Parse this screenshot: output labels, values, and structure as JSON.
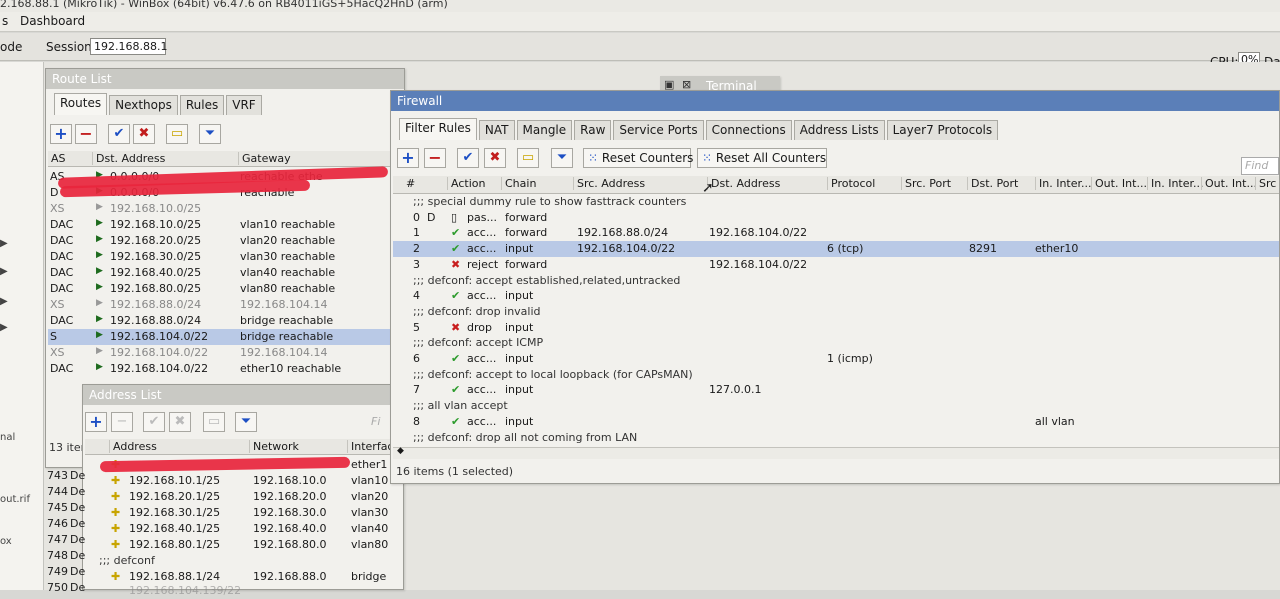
{
  "titlebar": {
    "text": "2.168.88.1 (MikroTik) - WinBox (64bit) v6.47.6 on RB4011iGS+5HacQ2HnD (arm)"
  },
  "menubar": {
    "items": [
      "s",
      "Dashboard"
    ]
  },
  "toolbar": {
    "mode_label": "ode",
    "session_label": "Session:",
    "session_value": "192.168.88.1",
    "cpu_label": "CPU:",
    "cpu_value": "0%",
    "right_label": "Da"
  },
  "left_strip": {
    "labels": [
      "nal",
      "out.rif",
      "ox"
    ]
  },
  "route_list": {
    "title": "Route List",
    "tabs": [
      "Routes",
      "Nexthops",
      "Rules",
      "VRF"
    ],
    "columns": [
      "AS",
      "Dst. Address",
      "Gateway"
    ],
    "rows": [
      {
        "flags": "AS",
        "dst": "0.0.0.0/0",
        "gw": "reachable ethe"
      },
      {
        "flags": "D",
        "dst": "0.0.0.0/0",
        "gw": "reachable"
      },
      {
        "flags": "XS",
        "dst": "192.168.10.0/25",
        "gw": ""
      },
      {
        "flags": "DAC",
        "dst": "192.168.10.0/25",
        "gw": "vlan10 reachable"
      },
      {
        "flags": "DAC",
        "dst": "192.168.20.0/25",
        "gw": "vlan20 reachable"
      },
      {
        "flags": "DAC",
        "dst": "192.168.30.0/25",
        "gw": "vlan30 reachable"
      },
      {
        "flags": "DAC",
        "dst": "192.168.40.0/25",
        "gw": "vlan40 reachable"
      },
      {
        "flags": "DAC",
        "dst": "192.168.80.0/25",
        "gw": "vlan80 reachable"
      },
      {
        "flags": "XS",
        "dst": "192.168.88.0/24",
        "gw": "192.168.104.14"
      },
      {
        "flags": "DAC",
        "dst": "192.168.88.0/24",
        "gw": "bridge reachable"
      },
      {
        "flags": "S",
        "dst": "192.168.104.0/22",
        "gw": "bridge reachable"
      },
      {
        "flags": "XS",
        "dst": "192.168.104.0/22",
        "gw": "192.168.104.14"
      },
      {
        "flags": "DAC",
        "dst": "192.168.104.0/22",
        "gw": "ether10 reachable"
      }
    ],
    "status": "13 item"
  },
  "address_list": {
    "title": "Address List",
    "find_label": "Fi",
    "columns": [
      "Address",
      "Network",
      "Interfac"
    ],
    "rows": [
      {
        "addr": "",
        "net": "",
        "iface": "ether1"
      },
      {
        "addr": "192.168.10.1/25",
        "net": "192.168.10.0",
        "iface": "vlan10"
      },
      {
        "addr": "192.168.20.1/25",
        "net": "192.168.20.0",
        "iface": "vlan20"
      },
      {
        "addr": "192.168.30.1/25",
        "net": "192.168.30.0",
        "iface": "vlan30"
      },
      {
        "addr": "192.168.40.1/25",
        "net": "192.168.40.0",
        "iface": "vlan40"
      },
      {
        "addr": "192.168.80.1/25",
        "net": "192.168.80.0",
        "iface": "vlan80"
      }
    ],
    "defconf": ";;; defconf",
    "defconf_row": {
      "addr": "192.168.88.1/24",
      "net": "192.168.88.0",
      "iface": "bridge"
    },
    "last_row": "192.168.104.139/22",
    "side_nums": [
      "743",
      "744",
      "745",
      "746",
      "747",
      "748",
      "749",
      "750"
    ],
    "side_vals": [
      "De",
      "De",
      "De",
      "De",
      "De",
      "De",
      "De",
      "De"
    ]
  },
  "terminal": {
    "title": "Terminal"
  },
  "firewall": {
    "title": "Firewall",
    "tabs": [
      "Filter Rules",
      "NAT",
      "Mangle",
      "Raw",
      "Service Ports",
      "Connections",
      "Address Lists",
      "Layer7 Protocols"
    ],
    "reset_counters": "Reset Counters",
    "reset_all_counters": "Reset All Counters",
    "find_placeholder": "Find",
    "columns": [
      "#",
      "Action",
      "Chain",
      "Src. Address",
      "Dst. Address",
      "Protocol",
      "Src. Port",
      "Dst. Port",
      "In. Inter...",
      "Out. Int...",
      "In. Inter...",
      "Out. Int...",
      "Src"
    ],
    "rows": [
      {
        "type": "comment",
        "text": ";;; special dummy rule to show fasttrack counters"
      },
      {
        "type": "rule",
        "num": "0",
        "flag": "D",
        "action": "pas...",
        "chain": "forward",
        "src": "",
        "dst": "",
        "proto": "",
        "dport": "",
        "inif": "",
        "icon": "pass"
      },
      {
        "type": "rule",
        "num": "1",
        "flag": "",
        "action": "acc...",
        "chain": "forward",
        "src": "192.168.88.0/24",
        "dst": "192.168.104.0/22",
        "proto": "",
        "dport": "",
        "inif": "",
        "icon": "ok"
      },
      {
        "type": "rule",
        "num": "2",
        "flag": "",
        "action": "acc...",
        "chain": "input",
        "src": "192.168.104.0/22",
        "dst": "",
        "proto": "6 (tcp)",
        "dport": "8291",
        "inif": "ether10",
        "icon": "ok",
        "selected": true
      },
      {
        "type": "rule",
        "num": "3",
        "flag": "",
        "action": "reject",
        "chain": "forward",
        "src": "",
        "dst": "192.168.104.0/22",
        "proto": "",
        "dport": "",
        "inif": "",
        "icon": "rej"
      },
      {
        "type": "comment",
        "text": ";;; defconf: accept established,related,untracked"
      },
      {
        "type": "rule",
        "num": "4",
        "flag": "",
        "action": "acc...",
        "chain": "input",
        "src": "",
        "dst": "",
        "proto": "",
        "dport": "",
        "inif": "",
        "icon": "ok"
      },
      {
        "type": "comment",
        "text": ";;; defconf: drop invalid"
      },
      {
        "type": "rule",
        "num": "5",
        "flag": "",
        "action": "drop",
        "chain": "input",
        "src": "",
        "dst": "",
        "proto": "",
        "dport": "",
        "inif": "",
        "icon": "rej"
      },
      {
        "type": "comment",
        "text": ";;; defconf: accept ICMP"
      },
      {
        "type": "rule",
        "num": "6",
        "flag": "",
        "action": "acc...",
        "chain": "input",
        "src": "",
        "dst": "",
        "proto": "1 (icmp)",
        "dport": "",
        "inif": "",
        "icon": "ok"
      },
      {
        "type": "comment",
        "text": ";;; defconf: accept to local loopback (for CAPsMAN)"
      },
      {
        "type": "rule",
        "num": "7",
        "flag": "",
        "action": "acc...",
        "chain": "input",
        "src": "",
        "dst": "127.0.0.1",
        "proto": "",
        "dport": "",
        "inif": "",
        "icon": "ok"
      },
      {
        "type": "comment",
        "text": ";;; all vlan accept"
      },
      {
        "type": "rule",
        "num": "8",
        "flag": "",
        "action": "acc...",
        "chain": "input",
        "src": "",
        "dst": "",
        "proto": "",
        "dport": "",
        "inif": "all vlan",
        "icon": "ok"
      },
      {
        "type": "comment",
        "text": ";;; defconf: drop all not coming from LAN"
      }
    ],
    "status": "16 items (1 selected)"
  }
}
